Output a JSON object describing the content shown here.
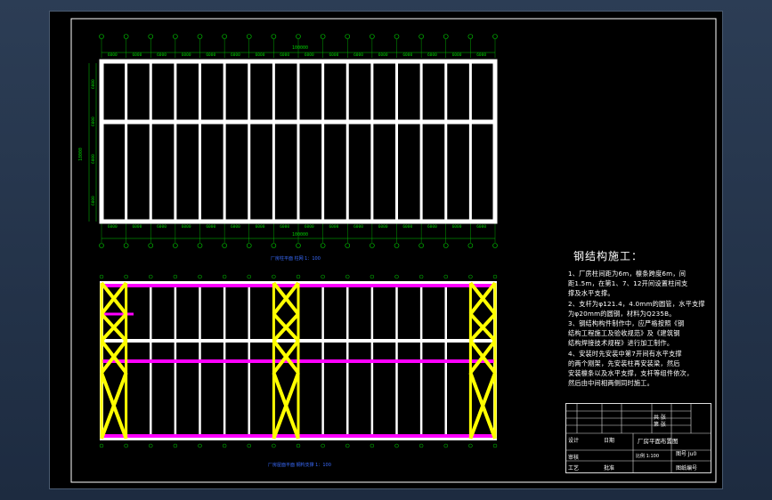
{
  "plan_top": {
    "caption": "厂房柱平面 柱网 1：100",
    "overall_dim": "100000",
    "column_spacing": [
      "6000",
      "6000",
      "6000",
      "6000",
      "6000",
      "6000",
      "6000",
      "6000",
      "6000",
      "6000",
      "6000",
      "6000",
      "6000",
      "6000",
      "6000",
      "6000"
    ],
    "left_dims": [
      "6000",
      "6000",
      "6000",
      "6000"
    ],
    "left_total": "18000",
    "total_span": "100000"
  },
  "plan_bottom": {
    "caption": "厂房屋面平面 钢构支撑 1：100"
  },
  "notes": {
    "title": "钢结构施工：",
    "items": [
      "1、厂房柱间距为6m，檩条跨度6m，间",
      "距1.5m，在第1、7、12开间设置柱间支",
      "撑及水平支撑。",
      "2、支杆为φ121.4，4.0mm的圆管，水平支撑",
      "为φ20mm的圆钢，材料为Q235B。",
      "3、钢结构构件制作中，应严格按照《钢",
      "结构工程施工及验收规范》及《建筑钢",
      "结构焊接技术规程》进行加工制作。",
      "4、安装时先安装中第7开间有水平支撑",
      "的两个刚架，先安装柱再安装梁，然后",
      "安装檩条以及水平支撑，支杆等组件依次，",
      "然后由中间相两侧同时施工。"
    ]
  },
  "title_block": {
    "drawing_name": "厂房平面布置图",
    "sheet": "图号 Ju0",
    "scale": "比例 1:100",
    "school": "图纸编号",
    "cells": [
      "设计",
      "审核",
      "工艺",
      "批准",
      "日期",
      "共 张",
      "第 张"
    ]
  },
  "colors": {
    "frame": "#ffffff",
    "dim": "#00cc00",
    "bracing": "#ffff00",
    "beam": "#ff00ff",
    "background": "#000000"
  }
}
